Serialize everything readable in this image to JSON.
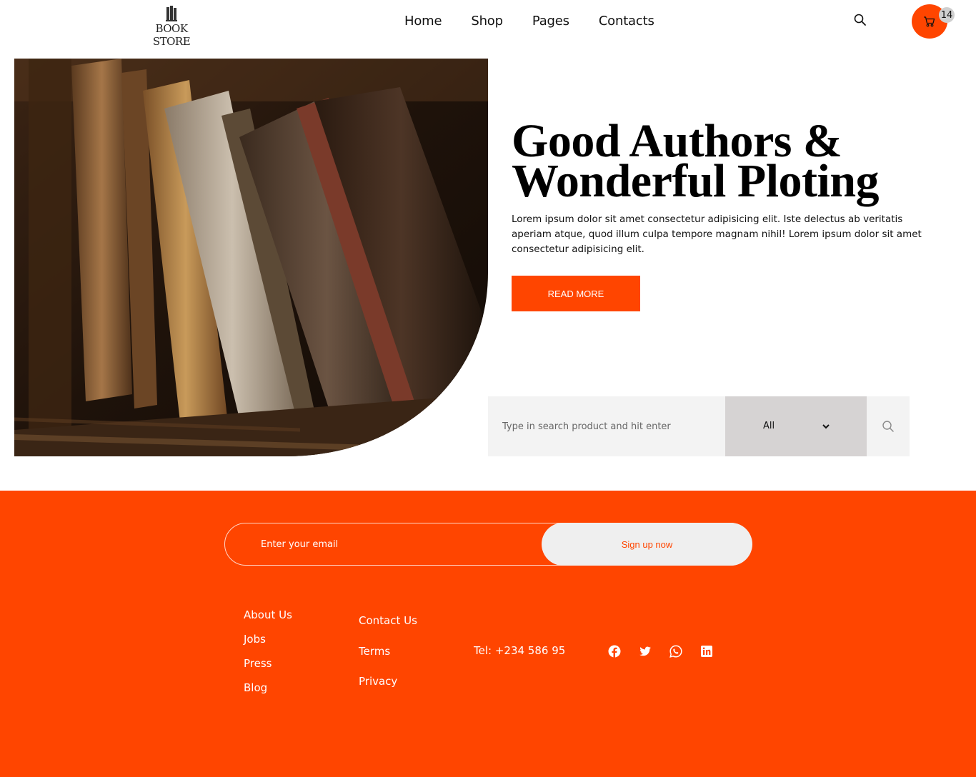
{
  "header": {
    "logo_text": "BOOK STORE",
    "nav": [
      {
        "label": "Home"
      },
      {
        "label": "Shop"
      },
      {
        "label": "Pages"
      },
      {
        "label": "Contacts"
      }
    ],
    "cart_count": "14",
    "icons": {
      "search": "search-icon",
      "cart": "cart-icon"
    }
  },
  "hero": {
    "title_line1": "Good Authors &",
    "title_line2": "Wonderful Ploting",
    "description": "Lorem ipsum dolor sit amet consectetur adipisicing elit. Iste delectus ab veritatis aperiam atque, quod illum culpa tempore magnam nihil! Lorem ipsum dolor sit amet consectetur adipisicing elit.",
    "button_label": "READ MORE"
  },
  "search": {
    "placeholder": "Type in search product and hit enter",
    "category_selected": "All"
  },
  "footer": {
    "email_placeholder": "Enter your email",
    "signup_label": "Sign up now",
    "links_col1": [
      "About Us",
      "Jobs",
      "Press",
      "Blog"
    ],
    "links_col2": [
      "Contact Us",
      "Terms",
      "Privacy"
    ],
    "tel": "Tel: +234 586 95",
    "socials": [
      "facebook-icon",
      "twitter-icon",
      "whatsapp-icon",
      "linkedin-icon"
    ]
  },
  "colors": {
    "accent": "#ff4500",
    "search_bg": "#f3f3f3",
    "select_bg": "#d6d3d3",
    "signup_bg": "#efefef"
  }
}
